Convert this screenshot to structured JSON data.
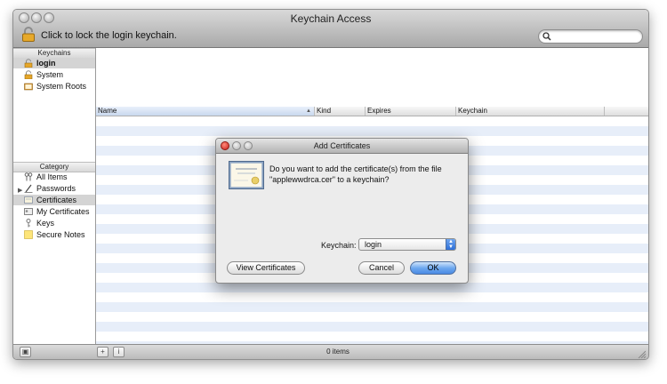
{
  "window": {
    "title": "Keychain Access",
    "lock_message": "Click to lock the login keychain."
  },
  "search": {
    "placeholder": ""
  },
  "sidebar": {
    "keychains_header": "Keychains",
    "keychains": [
      {
        "label": "login",
        "icon": "lock-icon",
        "selected": true
      },
      {
        "label": "System",
        "icon": "lock-icon"
      },
      {
        "label": "System Roots",
        "icon": "folder-icon"
      }
    ],
    "category_header": "Category",
    "categories": [
      {
        "label": "All Items",
        "icon": "key-people-icon"
      },
      {
        "label": "Passwords",
        "icon": "pencil-icon"
      },
      {
        "label": "Certificates",
        "icon": "certificate-icon",
        "selected": true
      },
      {
        "label": "My Certificates",
        "icon": "id-card-icon"
      },
      {
        "label": "Keys",
        "icon": "key-icon"
      },
      {
        "label": "Secure Notes",
        "icon": "note-icon"
      }
    ]
  },
  "table": {
    "columns": [
      "Name",
      "Kind",
      "Expires",
      "Keychain"
    ],
    "sort_indicator": "▲"
  },
  "status": {
    "item_count": "0 items"
  },
  "dialog": {
    "title": "Add Certificates",
    "question": "Do you want to add the certificate(s) from the file \"applewwdrca.cer\" to a keychain?",
    "keychain_label": "Keychain:",
    "keychain_value": "login",
    "view_certificates": "View Certificates",
    "cancel": "Cancel",
    "ok": "OK"
  },
  "colors": {
    "selection_row": "#d4d4d4",
    "stripe": "#e7eef9",
    "primary_button": "#4a8ae3"
  }
}
